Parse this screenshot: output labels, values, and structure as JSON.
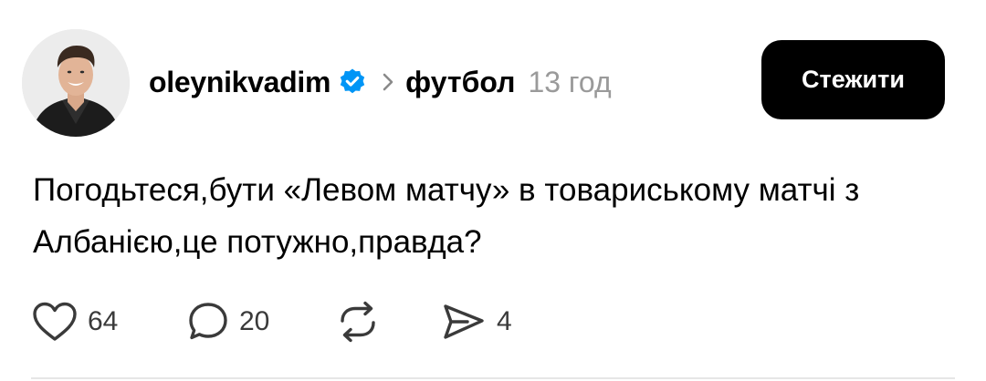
{
  "post": {
    "author": {
      "username": "oleynikvadim",
      "verified_icon": "verified-badge-icon",
      "avatar_icon": "user-avatar"
    },
    "topic": "футбол",
    "time": "13 год",
    "follow_label": "Стежити",
    "text": "Погодьтеся,бути «Левом матчу» в товариському матчі з Албанією,це потужно,правда?",
    "actions": {
      "like_count": "64",
      "comment_count": "20",
      "share_count": "4"
    }
  },
  "colors": {
    "accent": "#0095f6",
    "button_bg": "#000000",
    "muted": "#9a9a9a"
  }
}
